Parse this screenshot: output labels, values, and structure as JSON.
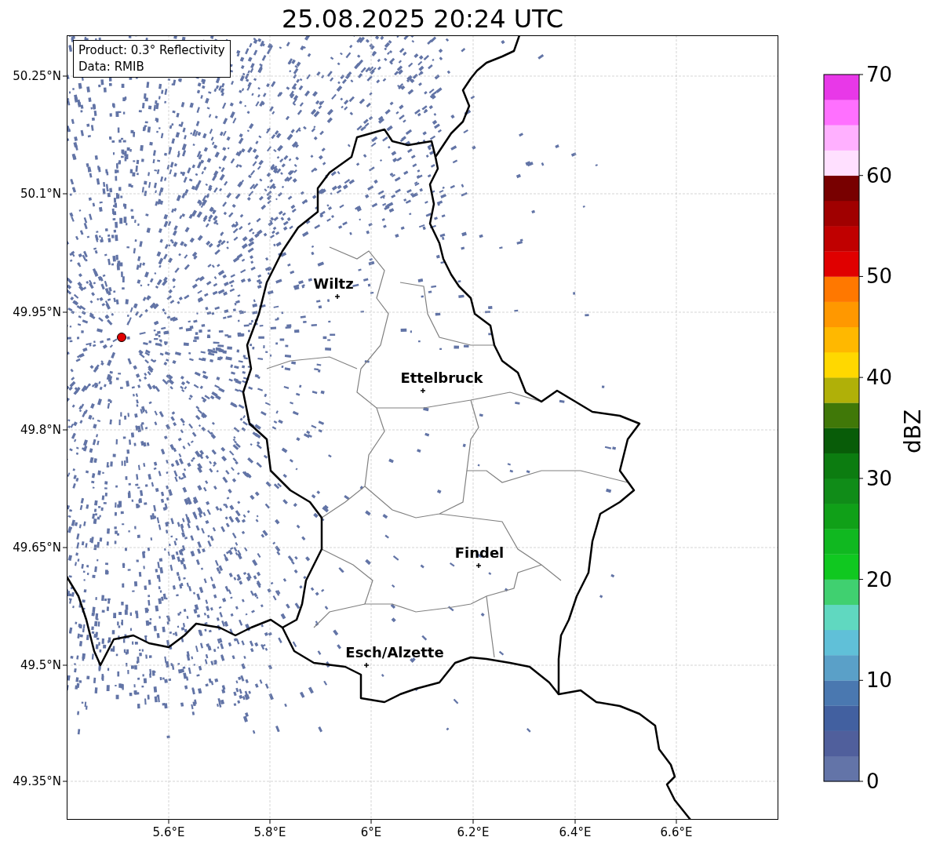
{
  "title": "25.08.2025 20:24 UTC",
  "info": [
    "Product: 0.3° Reflectivity",
    "Data: RMIB"
  ],
  "lat_labels": [
    "50.25°N",
    "50.1°N",
    "49.95°N",
    "49.8°N",
    "49.65°N",
    "49.5°N",
    "49.35°N"
  ],
  "lon_labels": [
    "5.6°E",
    "5.8°E",
    "6°E",
    "6.2°E",
    "6.4°E",
    "6.6°E"
  ],
  "cities": [
    {
      "name": "Wiltz"
    },
    {
      "name": "Ettelbruck"
    },
    {
      "name": "Findel"
    },
    {
      "name": "Esch/Alzette"
    }
  ],
  "colorbar": {
    "label": "dBZ",
    "ticks": [
      "70",
      "60",
      "50",
      "40",
      "30",
      "20",
      "10",
      "0"
    ],
    "segments": [
      {
        "color": "#6374a8"
      },
      {
        "color": "#505f9c"
      },
      {
        "color": "#4260a0"
      },
      {
        "color": "#4a78b0"
      },
      {
        "color": "#5aa0c8"
      },
      {
        "color": "#60c0d8"
      },
      {
        "color": "#60d8c0"
      },
      {
        "color": "#40d070"
      },
      {
        "color": "#10c820"
      },
      {
        "color": "#10b820"
      },
      {
        "color": "#10a018"
      },
      {
        "color": "#108c18"
      },
      {
        "color": "#0c7c10"
      },
      {
        "color": "#085c08"
      },
      {
        "color": "#407808"
      },
      {
        "color": "#b0b008"
      },
      {
        "color": "#ffd800"
      },
      {
        "color": "#ffb800"
      },
      {
        "color": "#ff9800"
      },
      {
        "color": "#ff7800"
      },
      {
        "color": "#e00000"
      },
      {
        "color": "#c00000"
      },
      {
        "color": "#a00000"
      },
      {
        "color": "#780000"
      },
      {
        "color": "#ffe0ff"
      },
      {
        "color": "#ffb0ff"
      },
      {
        "color": "#ff70ff"
      },
      {
        "color": "#e838e8"
      }
    ]
  }
}
